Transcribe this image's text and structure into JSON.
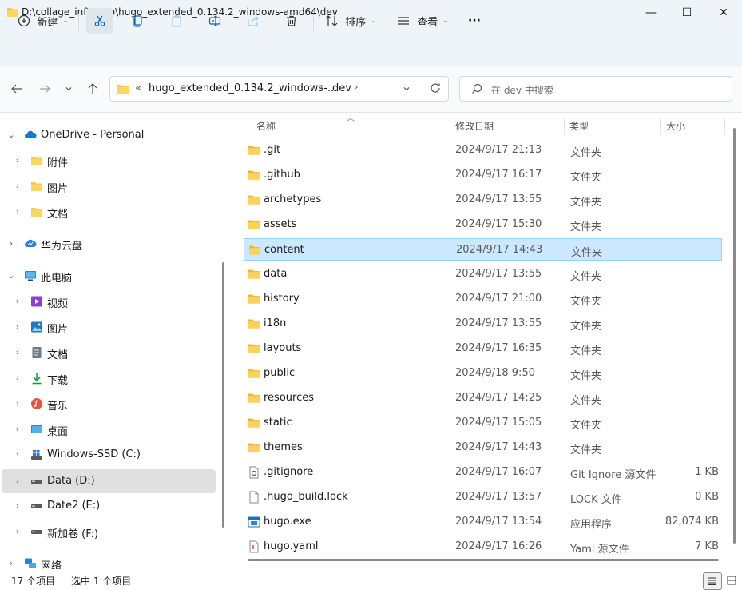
{
  "window": {
    "title": "D:\\collage_inf\\Hugo\\hugo_extended_0.134.2_windows-amd64\\dev",
    "minimize": "—",
    "maximize": "☐",
    "close": "✕"
  },
  "toolbar": {
    "new_label": "新建",
    "sort_label": "排序",
    "view_label": "查看",
    "more_label": "···"
  },
  "address": {
    "overflow": "«",
    "crumb_parent": "hugo_extended_0.134.2_windows-...",
    "crumb_current": "dev",
    "search_placeholder": "在 dev 中搜索"
  },
  "sidebar": {
    "items": [
      {
        "label": "OneDrive - Personal",
        "icon": "onedrive-icon"
      },
      {
        "label": "附件",
        "icon": "folder-icon"
      },
      {
        "label": "图片",
        "icon": "folder-icon"
      },
      {
        "label": "文档",
        "icon": "folder-icon"
      },
      {
        "label": "华为云盘",
        "icon": "cloud-icon"
      },
      {
        "label": "此电脑",
        "icon": "pc-icon"
      },
      {
        "label": "视频",
        "icon": "video-icon"
      },
      {
        "label": "图片",
        "icon": "pictures-icon"
      },
      {
        "label": "文档",
        "icon": "documents-icon"
      },
      {
        "label": "下载",
        "icon": "download-icon"
      },
      {
        "label": "音乐",
        "icon": "music-icon"
      },
      {
        "label": "桌面",
        "icon": "desktop-icon"
      },
      {
        "label": "Windows-SSD (C:)",
        "icon": "windows-drive-icon"
      },
      {
        "label": "Data (D:)",
        "icon": "drive-icon"
      },
      {
        "label": "Date2 (E:)",
        "icon": "drive-icon"
      },
      {
        "label": "新加卷 (F:)",
        "icon": "drive-icon"
      },
      {
        "label": "网络",
        "icon": "network-icon"
      }
    ]
  },
  "columns": {
    "name": "名称",
    "modified": "修改日期",
    "type": "类型",
    "size": "大小"
  },
  "files": [
    {
      "name": ".git",
      "date": "2024/9/17 21:13",
      "type": "文件夹",
      "size": "",
      "kind": "folder"
    },
    {
      "name": ".github",
      "date": "2024/9/17 16:17",
      "type": "文件夹",
      "size": "",
      "kind": "folder"
    },
    {
      "name": "archetypes",
      "date": "2024/9/17 13:55",
      "type": "文件夹",
      "size": "",
      "kind": "folder"
    },
    {
      "name": "assets",
      "date": "2024/9/17 15:30",
      "type": "文件夹",
      "size": "",
      "kind": "folder"
    },
    {
      "name": "content",
      "date": "2024/9/17 14:43",
      "type": "文件夹",
      "size": "",
      "kind": "folder"
    },
    {
      "name": "data",
      "date": "2024/9/17 13:55",
      "type": "文件夹",
      "size": "",
      "kind": "folder"
    },
    {
      "name": "history",
      "date": "2024/9/17 21:00",
      "type": "文件夹",
      "size": "",
      "kind": "folder"
    },
    {
      "name": "i18n",
      "date": "2024/9/17 13:55",
      "type": "文件夹",
      "size": "",
      "kind": "folder"
    },
    {
      "name": "layouts",
      "date": "2024/9/17 16:35",
      "type": "文件夹",
      "size": "",
      "kind": "folder"
    },
    {
      "name": "public",
      "date": "2024/9/18 9:50",
      "type": "文件夹",
      "size": "",
      "kind": "folder"
    },
    {
      "name": "resources",
      "date": "2024/9/17 14:25",
      "type": "文件夹",
      "size": "",
      "kind": "folder"
    },
    {
      "name": "static",
      "date": "2024/9/17 15:05",
      "type": "文件夹",
      "size": "",
      "kind": "folder"
    },
    {
      "name": "themes",
      "date": "2024/9/17 14:43",
      "type": "文件夹",
      "size": "",
      "kind": "folder"
    },
    {
      "name": ".gitignore",
      "date": "2024/9/17 16:07",
      "type": "Git Ignore 源文件",
      "size": "1 KB",
      "kind": "gitignore"
    },
    {
      "name": ".hugo_build.lock",
      "date": "2024/9/17 13:57",
      "type": "LOCK 文件",
      "size": "0 KB",
      "kind": "file"
    },
    {
      "name": "hugo.exe",
      "date": "2024/9/17 13:54",
      "type": "应用程序",
      "size": "82,074 KB",
      "kind": "exe"
    },
    {
      "name": "hugo.yaml",
      "date": "2024/9/17 16:26",
      "type": "Yaml 源文件",
      "size": "7 KB",
      "kind": "yaml"
    }
  ],
  "selected_file": "content",
  "selected_drive": "Data (D:)",
  "status": {
    "count": "17 个项目",
    "selection": "选中 1 个项目"
  },
  "colors": {
    "folder": "#f4c64b",
    "selection": "#cce8ff",
    "accent": "#0067c0"
  }
}
